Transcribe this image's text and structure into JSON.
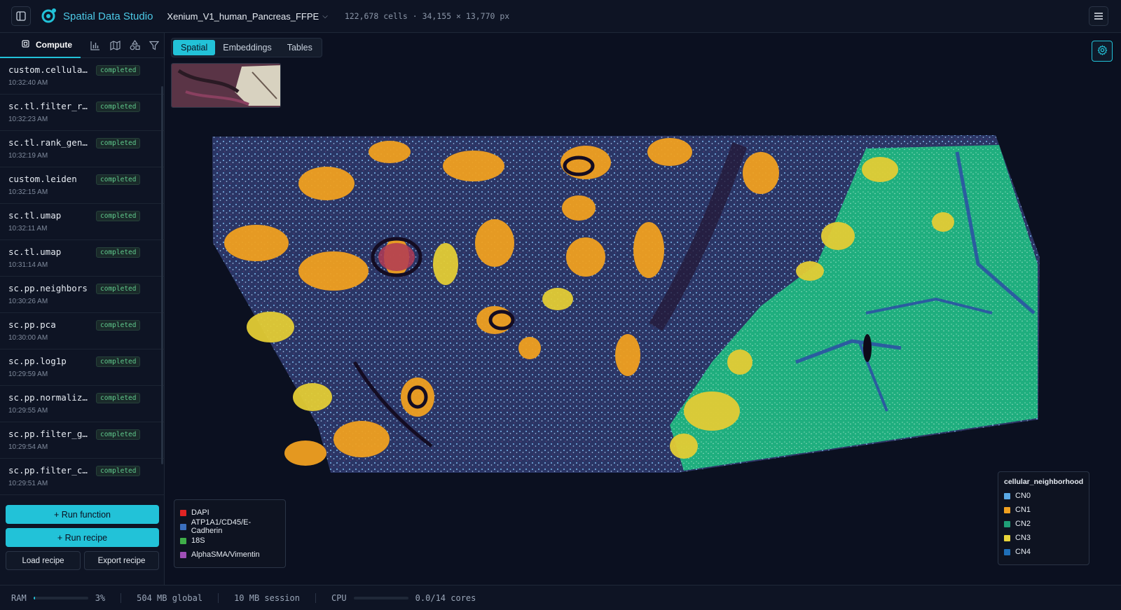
{
  "header": {
    "app_name": "Spatial Data Studio",
    "dataset": "Xenium_V1_human_Pancreas_FFPE",
    "stats": "122,678 cells · 34,155 × 13,770 px",
    "icons": [
      "sidebar-toggle-icon",
      "logo-icon",
      "chevron-down-icon",
      "menu-icon"
    ]
  },
  "sidebar": {
    "active_tab": "Compute",
    "tab_icons": [
      "bar-chart-icon",
      "map-icon",
      "shapes-icon",
      "filter-icon"
    ],
    "history": [
      {
        "name": "custom.cellular_neighborhoods",
        "time": "10:32:40 AM",
        "status": "completed"
      },
      {
        "name": "sc.tl.filter_rank_genes_groups",
        "time": "10:32:23 AM",
        "status": "completed"
      },
      {
        "name": "sc.tl.rank_genes_groups",
        "time": "10:32:19 AM",
        "status": "completed"
      },
      {
        "name": "custom.leiden",
        "time": "10:32:15 AM",
        "status": "completed"
      },
      {
        "name": "sc.tl.umap",
        "time": "10:32:11 AM",
        "status": "completed"
      },
      {
        "name": "sc.tl.umap",
        "time": "10:31:14 AM",
        "status": "completed"
      },
      {
        "name": "sc.pp.neighbors",
        "time": "10:30:26 AM",
        "status": "completed"
      },
      {
        "name": "sc.pp.pca",
        "time": "10:30:00 AM",
        "status": "completed"
      },
      {
        "name": "sc.pp.log1p",
        "time": "10:29:59 AM",
        "status": "completed"
      },
      {
        "name": "sc.pp.normalize_total",
        "time": "10:29:55 AM",
        "status": "completed"
      },
      {
        "name": "sc.pp.filter_genes",
        "time": "10:29:54 AM",
        "status": "completed"
      },
      {
        "name": "sc.pp.filter_cells",
        "time": "10:29:51 AM",
        "status": "completed"
      }
    ],
    "run_function": "+ Run function",
    "run_recipe": "+ Run recipe",
    "load_recipe": "Load recipe",
    "export_recipe": "Export recipe"
  },
  "main": {
    "tabs": [
      "Spatial",
      "Embeddings",
      "Tables"
    ],
    "active_tab": "Spatial",
    "channel_legend": [
      {
        "label": "DAPI",
        "color": "#e02424"
      },
      {
        "label": "ATP1A1/CD45/E-Cadherin",
        "color": "#3b6fbf"
      },
      {
        "label": "18S",
        "color": "#3fae49"
      },
      {
        "label": "AlphaSMA/Vimentin",
        "color": "#a04fb8"
      }
    ],
    "cluster_legend": {
      "title": "cellular_neighborhood",
      "items": [
        {
          "label": "CN0",
          "color": "#5aa9e6"
        },
        {
          "label": "CN1",
          "color": "#f0a020"
        },
        {
          "label": "CN2",
          "color": "#1f9e77"
        },
        {
          "label": "CN3",
          "color": "#e8d43a"
        },
        {
          "label": "CN4",
          "color": "#1f6fb8"
        }
      ]
    }
  },
  "status": {
    "ram_label": "RAM",
    "ram_percent": "3%",
    "ram_fraction": 0.03,
    "global": "504 MB global",
    "session": "10 MB session",
    "cpu_label": "CPU",
    "cpu_value": "0.0/14 cores",
    "cpu_fraction": 0.0
  }
}
